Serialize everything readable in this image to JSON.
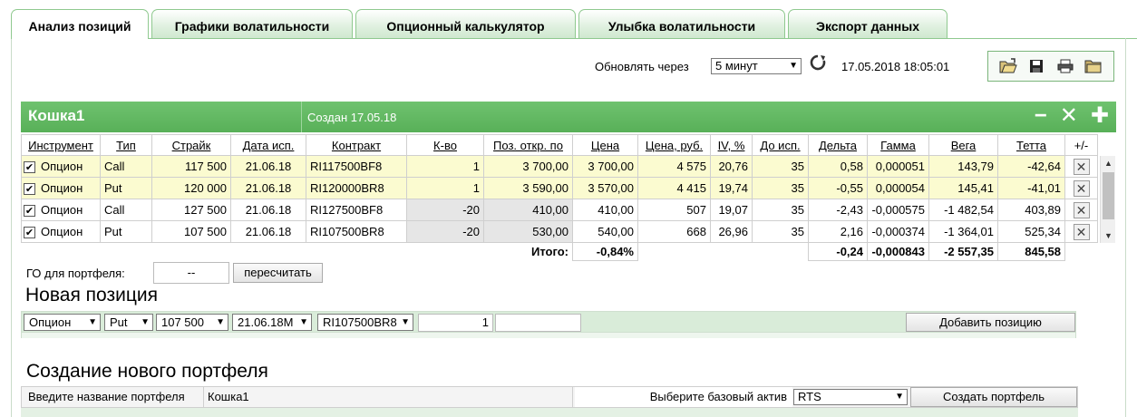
{
  "tabs": [
    {
      "label": "Анализ позиций",
      "active": true
    },
    {
      "label": "Графики волатильности",
      "active": false
    },
    {
      "label": "Опционный калькулятор",
      "active": false
    },
    {
      "label": "Улыбка волатильности",
      "active": false
    },
    {
      "label": "Экспорт данных",
      "active": false
    }
  ],
  "refresh": {
    "label": "Обновлять через",
    "interval": "5 минут",
    "timestamp": "17.05.2018 18:05:01"
  },
  "toolbar_icons": [
    "open-folder-icon",
    "save-icon",
    "print-icon",
    "folder-icon"
  ],
  "portfolio": {
    "name": "Кошка1",
    "created": "Создан 17.05.18",
    "actions": {
      "minimize": "−",
      "close": "✕",
      "add": "✚"
    }
  },
  "table": {
    "headers": [
      "Инструмент",
      "Тип",
      "Страйк",
      "Дата исп.",
      "Контракт",
      "К-во",
      "Поз. откр. по",
      "Цена",
      "Цена, руб.",
      "IV, %",
      "До исп.",
      "Дельта",
      "Гамма",
      "Вега",
      "Тетта",
      "+/-"
    ],
    "rows": [
      {
        "instrument": "Опцион",
        "type": "Call",
        "strike": "117 500",
        "date": "21.06.18",
        "contract": "RI117500BF8",
        "qty": "1",
        "open": "3 700,00",
        "price": "3 700,00",
        "price_rub": "4 575",
        "iv": "20,76",
        "days": "35",
        "delta": "0,58",
        "gamma": "0,000051",
        "vega": "143,79",
        "theta": "-42,64",
        "highlight": true
      },
      {
        "instrument": "Опцион",
        "type": "Put",
        "strike": "120 000",
        "date": "21.06.18",
        "contract": "RI120000BR8",
        "qty": "1",
        "open": "3 590,00",
        "price": "3 570,00",
        "price_rub": "4 415",
        "iv": "19,74",
        "days": "35",
        "delta": "-0,55",
        "gamma": "0,000054",
        "vega": "145,41",
        "theta": "-41,01",
        "highlight": true
      },
      {
        "instrument": "Опцион",
        "type": "Call",
        "strike": "127 500",
        "date": "21.06.18",
        "contract": "RI127500BF8",
        "qty": "-20",
        "open": "410,00",
        "price": "410,00",
        "price_rub": "507",
        "iv": "19,07",
        "days": "35",
        "delta": "-2,43",
        "gamma": "-0,000575",
        "vega": "-1 482,54",
        "theta": "403,89",
        "highlight": false
      },
      {
        "instrument": "Опцион",
        "type": "Put",
        "strike": "107 500",
        "date": "21.06.18",
        "contract": "RI107500BR8",
        "qty": "-20",
        "open": "530,00",
        "price": "540,00",
        "price_rub": "668",
        "iv": "26,96",
        "days": "35",
        "delta": "2,16",
        "gamma": "-0,000374",
        "vega": "-1 364,01",
        "theta": "525,34",
        "highlight": false
      }
    ],
    "totals": {
      "label": "Итого:",
      "price": "-0,84%",
      "delta": "-0,24",
      "gamma": "-0,000843",
      "vega": "-2 557,35",
      "theta": "845,58"
    }
  },
  "go": {
    "label": "ГО для портфеля:",
    "value": "--",
    "button": "пересчитать"
  },
  "new_position": {
    "title": "Новая позиция",
    "instrument": "Опцион",
    "type": "Put",
    "strike": "107 500",
    "date": "21.06.18M",
    "contract": "RI107500BR8",
    "qty": "1",
    "price": "",
    "add_button": "Добавить позицию"
  },
  "create_portfolio": {
    "title": "Создание нового портфеля",
    "name_label": "Введите название портфеля",
    "name_value": "Кошка1",
    "asset_label": "Выберите базовый актив",
    "asset_value": "RTS",
    "button": "Создать портфель"
  }
}
